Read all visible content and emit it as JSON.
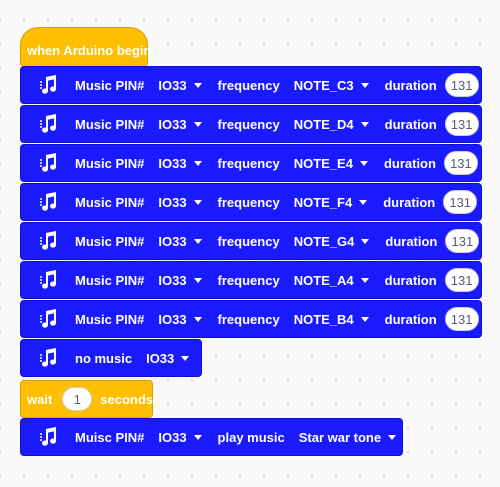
{
  "hat": {
    "label": "when Arduino begin"
  },
  "music_blocks": [
    {
      "pin_label": "Music PIN#",
      "pin": "IO33",
      "freq_label": "frequency",
      "note": "NOTE_C3",
      "dur_label": "duration",
      "duration": "131"
    },
    {
      "pin_label": "Music PIN#",
      "pin": "IO33",
      "freq_label": "frequency",
      "note": "NOTE_D4",
      "dur_label": "duration",
      "duration": "131"
    },
    {
      "pin_label": "Music PIN#",
      "pin": "IO33",
      "freq_label": "frequency",
      "note": "NOTE_E4",
      "dur_label": "duration",
      "duration": "131"
    },
    {
      "pin_label": "Music PIN#",
      "pin": "IO33",
      "freq_label": "frequency",
      "note": "NOTE_F4",
      "dur_label": "duration",
      "duration": "131"
    },
    {
      "pin_label": "Music PIN#",
      "pin": "IO33",
      "freq_label": "frequency",
      "note": "NOTE_G4",
      "dur_label": "duration",
      "duration": "131"
    },
    {
      "pin_label": "Music PIN#",
      "pin": "IO33",
      "freq_label": "frequency",
      "note": "NOTE_A4",
      "dur_label": "duration",
      "duration": "131"
    },
    {
      "pin_label": "Music PIN#",
      "pin": "IO33",
      "freq_label": "frequency",
      "note": "NOTE_B4",
      "dur_label": "duration",
      "duration": "131"
    }
  ],
  "no_music": {
    "label": "no music",
    "pin": "IO33"
  },
  "wait": {
    "label": "wait",
    "value": "1",
    "unit": "seconds"
  },
  "play_music": {
    "pin_label": "Muisc PIN#",
    "pin": "IO33",
    "play_label": "play music",
    "tune": "Star war tone"
  },
  "colors": {
    "event": "#ffbf00",
    "music": "#1a1aff",
    "canvas": "#f9f9f9"
  },
  "icons": {
    "music_block": "music-note-icon",
    "dropdown": "chevron-down-icon"
  }
}
